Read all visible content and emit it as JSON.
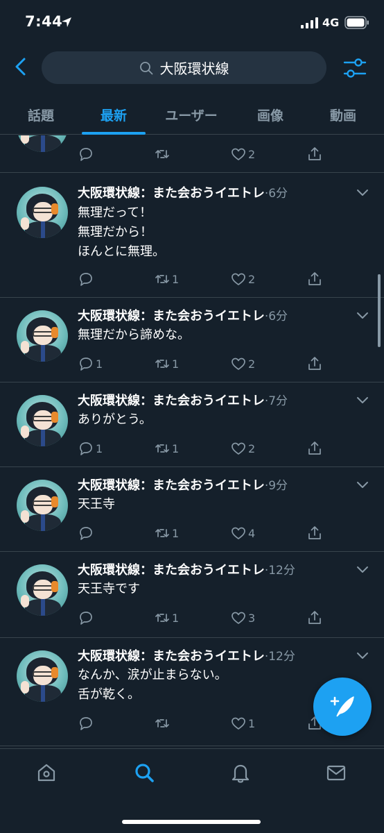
{
  "status_bar": {
    "time": "7:44",
    "network": "4G"
  },
  "search": {
    "query": "大阪環状線"
  },
  "tabs": [
    {
      "label": "話題"
    },
    {
      "label": "最新"
    },
    {
      "label": "ユーザー"
    },
    {
      "label": "画像"
    },
    {
      "label": "動画"
    }
  ],
  "active_tab": "最新",
  "tweets": [
    {
      "name": "",
      "time": "",
      "text": "",
      "reply": "",
      "retweet": "",
      "like": "2"
    },
    {
      "name": "大阪環状線：また会おうイエトレ",
      "time": "·6分",
      "text": "無理だって！\n無理だから！\nほんとに無理。",
      "reply": "",
      "retweet": "1",
      "like": "2"
    },
    {
      "name": "大阪環状線：また会おうイエトレ",
      "time": "·6分",
      "text": "無理だから諦めな。",
      "reply": "1",
      "retweet": "1",
      "like": "2"
    },
    {
      "name": "大阪環状線：また会おうイエトレ",
      "time": "·7分",
      "text": "ありがとう。",
      "reply": "1",
      "retweet": "1",
      "like": "2"
    },
    {
      "name": "大阪環状線：また会おうイエトレ",
      "time": "·9分",
      "text": "天王寺",
      "reply": "",
      "retweet": "1",
      "like": "4"
    },
    {
      "name": "大阪環状線：また会おうイエトレ",
      "time": "·12分",
      "text": "天王寺です",
      "reply": "",
      "retweet": "1",
      "like": "3"
    },
    {
      "name": "大阪環状線：また会おうイエトレ",
      "time": "·12分",
      "text": "なんか、涙が止まらない。\n舌が乾く。",
      "reply": "",
      "retweet": "",
      "like": "1"
    }
  ],
  "colors": {
    "background": "#15202b",
    "accent": "#1da1f2",
    "secondary_text": "#8899a6",
    "divider": "#38444d"
  },
  "icons": {
    "status": [
      "location-arrow-icon",
      "signal-icon",
      "battery-icon"
    ],
    "header": [
      "back-chevron-icon",
      "search-icon",
      "filter-sliders-icon"
    ],
    "tweet_actions": [
      "reply-icon",
      "retweet-icon",
      "like-heart-icon",
      "share-icon"
    ],
    "tab_bar": [
      "home-icon",
      "search-icon",
      "notifications-bell-icon",
      "messages-envelope-icon"
    ],
    "fab": "compose-tweet-icon"
  }
}
